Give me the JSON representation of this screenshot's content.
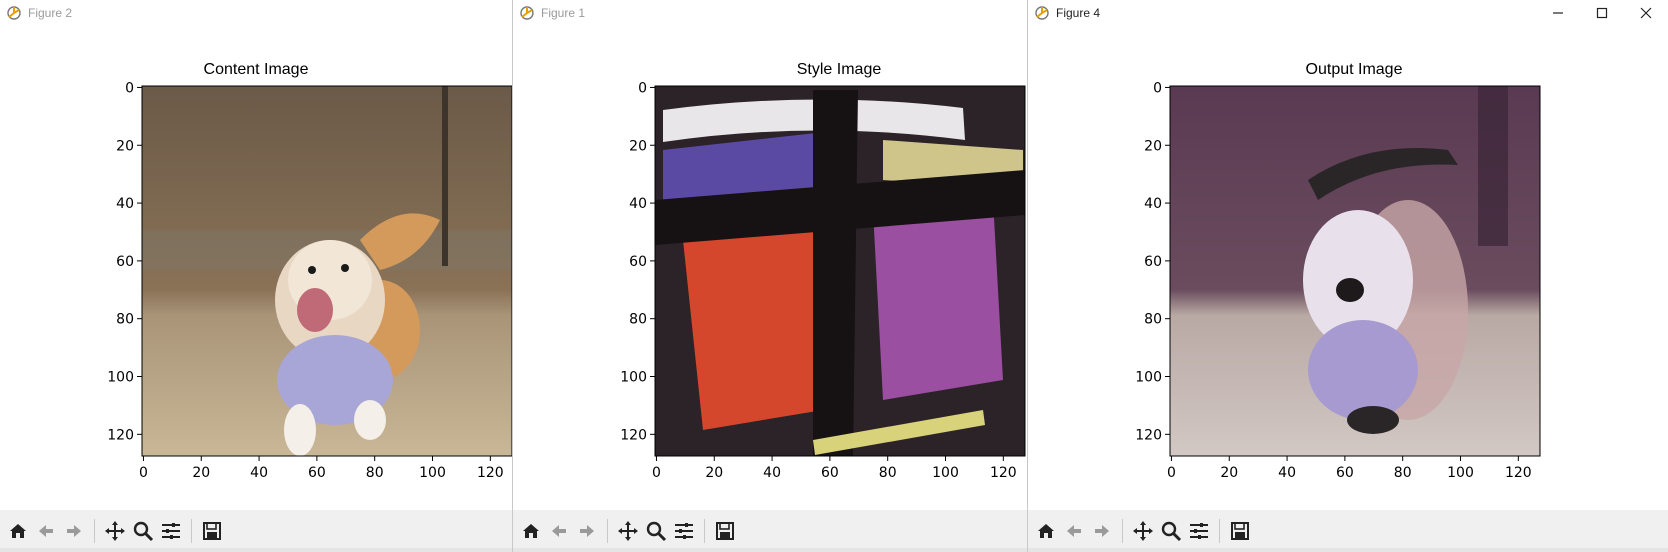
{
  "windows": [
    {
      "title": "Figure 2",
      "plot_title": "Content Image",
      "image_content": "corgi-running-in-purple-sweater",
      "x_ticks": [
        "0",
        "20",
        "40",
        "60",
        "80",
        "100",
        "120"
      ],
      "y_ticks": [
        "0",
        "20",
        "40",
        "60",
        "80",
        "100",
        "120"
      ],
      "active": false
    },
    {
      "title": "Figure 1",
      "plot_title": "Style Image",
      "image_content": "abstract-painting-dark-cross-red-purple-strokes",
      "x_ticks": [
        "0",
        "20",
        "40",
        "60",
        "80",
        "100",
        "120"
      ],
      "y_ticks": [
        "0",
        "20",
        "40",
        "60",
        "80",
        "100",
        "120"
      ],
      "active": false
    },
    {
      "title": "Figure 4",
      "plot_title": "Output Image",
      "image_content": "stylized-corgi-painted-texture",
      "x_ticks": [
        "0",
        "20",
        "40",
        "60",
        "80",
        "100",
        "120"
      ],
      "y_ticks": [
        "0",
        "20",
        "40",
        "60",
        "80",
        "100",
        "120"
      ],
      "active": true
    }
  ],
  "window_controls": [
    "minimize-icon",
    "maximize-icon",
    "close-icon"
  ],
  "toolbar_icons": [
    "home-icon",
    "back-arrow-icon",
    "forward-arrow-icon",
    "pan-move-icon",
    "zoom-magnifier-icon",
    "configure-subplots-icon",
    "save-figure-icon"
  ],
  "colors": {
    "toolbar_bg": "#f0f0f0",
    "title_inactive": "#9a9a9a",
    "title_active": "#222222",
    "axes_spine": "#000000"
  }
}
